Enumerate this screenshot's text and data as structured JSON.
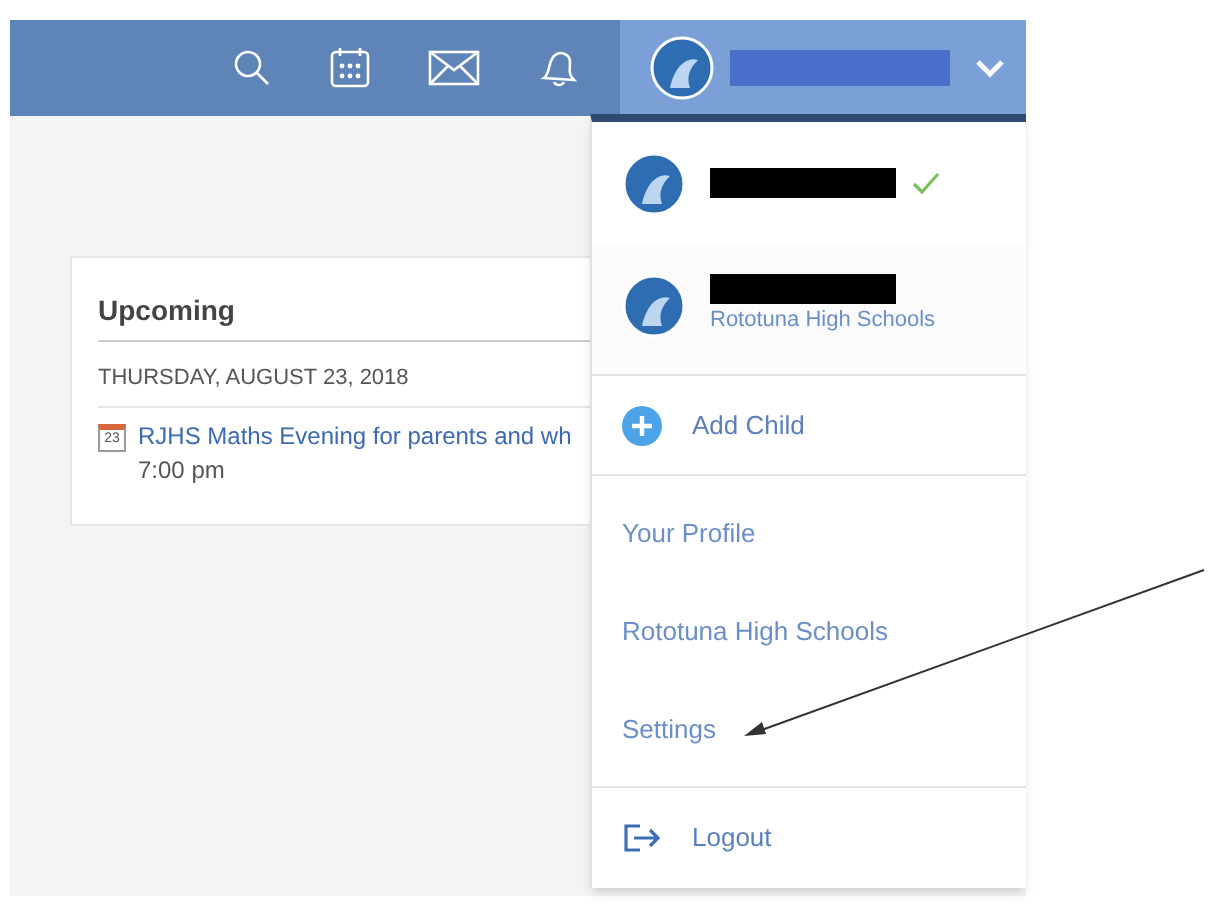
{
  "top_bar": {
    "user_menu": {
      "expanded": true
    }
  },
  "upcoming": {
    "title": "Upcoming",
    "date": "THURSDAY, AUGUST 23, 2018",
    "events": [
      {
        "icon_day": "23",
        "title": "RJHS Maths Evening for parents and wh",
        "time": "7:00 pm"
      }
    ]
  },
  "account_menu": {
    "accounts": [
      {
        "selected": true
      },
      {
        "selected": false,
        "school": "Rototuna High Schools"
      }
    ],
    "add_child": "Add Child",
    "links": [
      {
        "label": "Your Profile"
      },
      {
        "label": "Rototuna High Schools"
      },
      {
        "label": "Settings"
      }
    ],
    "logout": "Logout"
  }
}
